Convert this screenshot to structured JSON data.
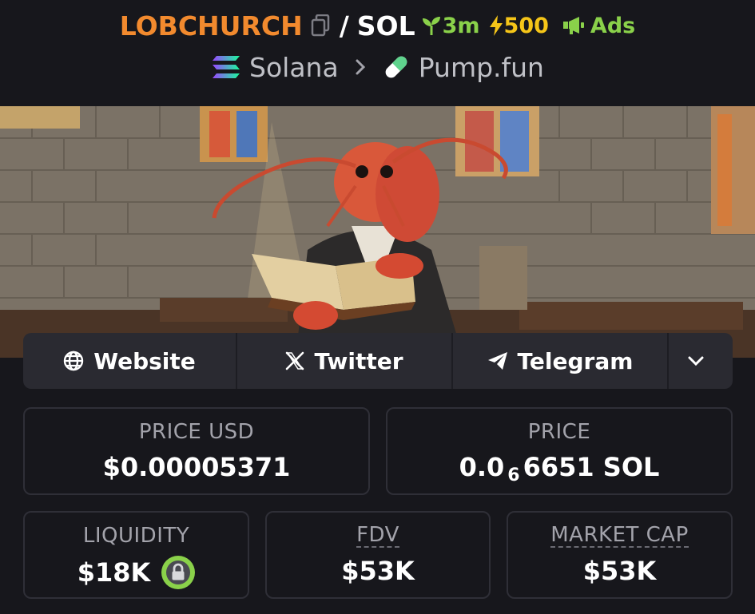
{
  "header": {
    "token_name": "LOBCHURCH",
    "separator": "/",
    "quote": "SOL",
    "age": "3m",
    "boost": "500",
    "ads_label": "Ads",
    "chain": "Solana",
    "dex": "Pump.fun"
  },
  "links": {
    "website": "Website",
    "twitter": "Twitter",
    "telegram": "Telegram"
  },
  "stats": {
    "price_usd_label": "PRICE USD",
    "price_usd_value": "$0.00005371",
    "price_label": "PRICE",
    "price_prefix": "0.0",
    "price_zero_count": "6",
    "price_digits": "6651 SOL",
    "liquidity_label": "LIQUIDITY",
    "liquidity_value": "$18K",
    "fdv_label": "FDV",
    "fdv_value": "$53K",
    "mcap_label": "MARKET CAP",
    "mcap_value": "$53K"
  },
  "colors": {
    "token_name": "#f28a2e",
    "accent_green": "#8ad14a",
    "boost_yellow": "#f5c518",
    "background": "#17171c",
    "button_bg": "#2a2a31"
  },
  "icons": [
    "copy-icon",
    "seedling-icon",
    "lightning-icon",
    "megaphone-icon",
    "solana-icon",
    "chevron-right-icon",
    "pill-icon",
    "globe-icon",
    "x-icon",
    "telegram-icon",
    "chevron-down-icon",
    "lock-icon"
  ]
}
